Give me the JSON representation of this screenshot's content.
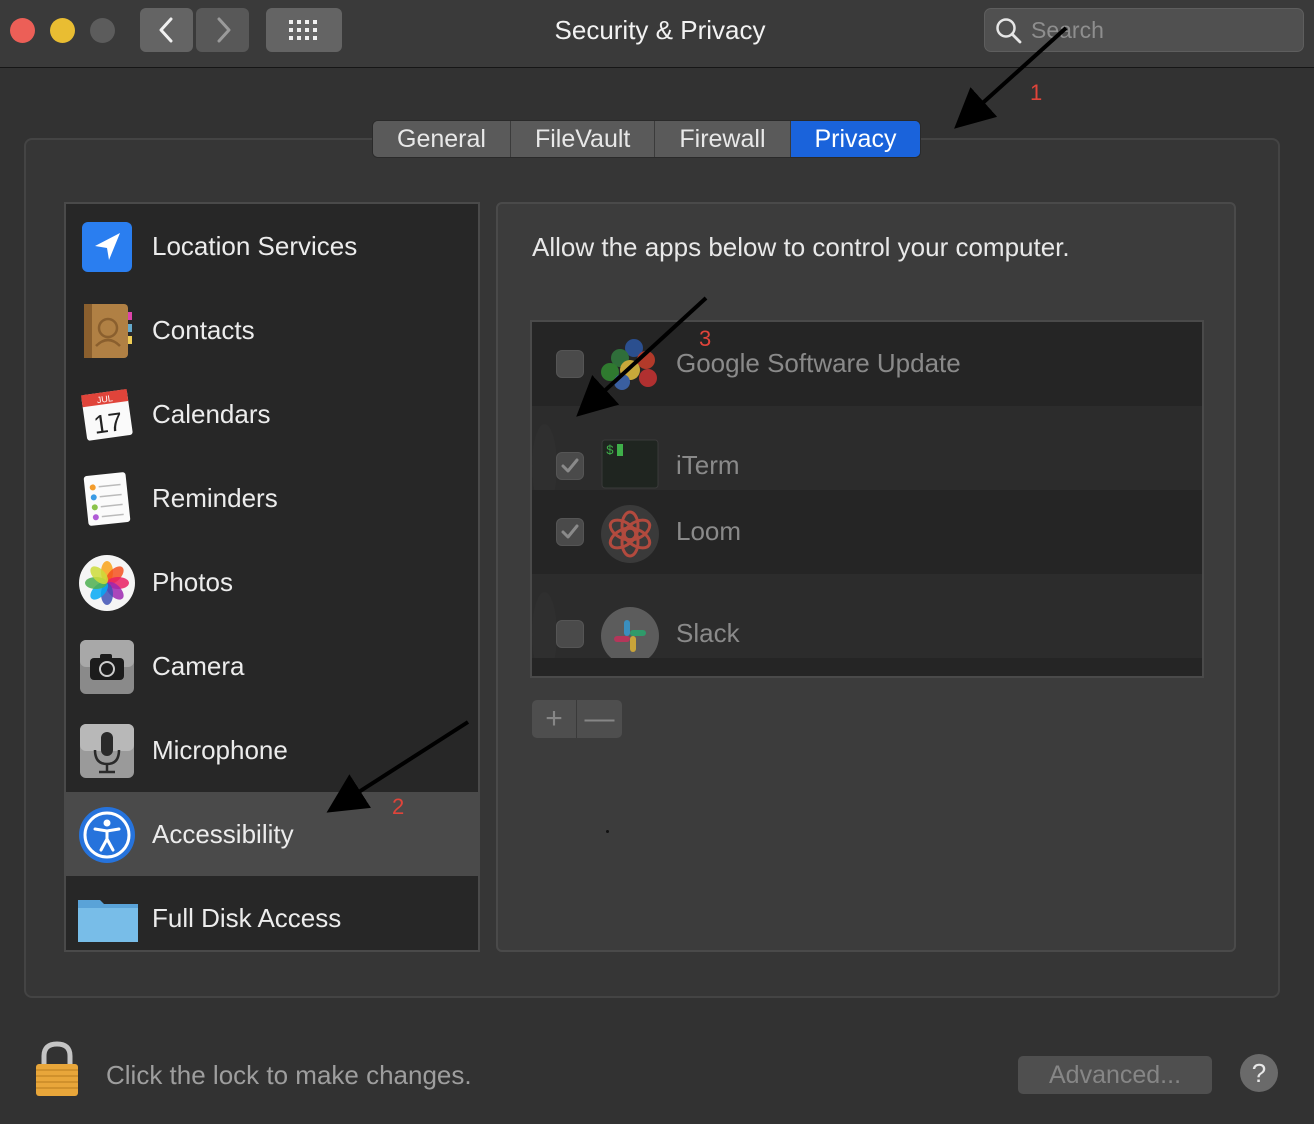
{
  "window": {
    "title": "Security & Privacy"
  },
  "search": {
    "placeholder": "Search"
  },
  "tabs": [
    {
      "label": "General",
      "active": false
    },
    {
      "label": "FileVault",
      "active": false
    },
    {
      "label": "Firewall",
      "active": false
    },
    {
      "label": "Privacy",
      "active": true
    }
  ],
  "sidebar": {
    "items": [
      {
        "label": "Location Services",
        "icon": "location-arrow-icon"
      },
      {
        "label": "Contacts",
        "icon": "contacts-book-icon"
      },
      {
        "label": "Calendars",
        "icon": "calendar-icon",
        "calendar_month": "JUL",
        "calendar_day": "17"
      },
      {
        "label": "Reminders",
        "icon": "reminders-icon"
      },
      {
        "label": "Photos",
        "icon": "photos-flower-icon"
      },
      {
        "label": "Camera",
        "icon": "camera-icon"
      },
      {
        "label": "Microphone",
        "icon": "microphone-icon"
      },
      {
        "label": "Accessibility",
        "icon": "accessibility-icon",
        "selected": true
      },
      {
        "label": "Full Disk Access",
        "icon": "folder-icon"
      }
    ]
  },
  "panel": {
    "title": "Allow the apps below to control your computer.",
    "apps": [
      {
        "name": "Google Software Update",
        "checked": false,
        "icon": "google-software-update-icon"
      },
      {
        "name": "iTerm",
        "checked": true,
        "icon": "iterm-icon",
        "icon_text": "$"
      },
      {
        "name": "Loom",
        "checked": true,
        "icon": "loom-icon"
      },
      {
        "name": "Slack",
        "checked": false,
        "icon": "slack-icon"
      }
    ],
    "add_label": "+",
    "remove_label": "—"
  },
  "footer": {
    "lock_text": "Click the lock to make changes.",
    "advanced_label": "Advanced...",
    "help_label": "?"
  },
  "annotations": [
    {
      "number": "1",
      "color": "#e0443a"
    },
    {
      "number": "2",
      "color": "#e0443a"
    },
    {
      "number": "3",
      "color": "#e0443a"
    }
  ],
  "colors": {
    "accent": "#1a63db",
    "window_bg": "#323232",
    "close": "#ec5f57",
    "minimize": "#e9bd32"
  }
}
